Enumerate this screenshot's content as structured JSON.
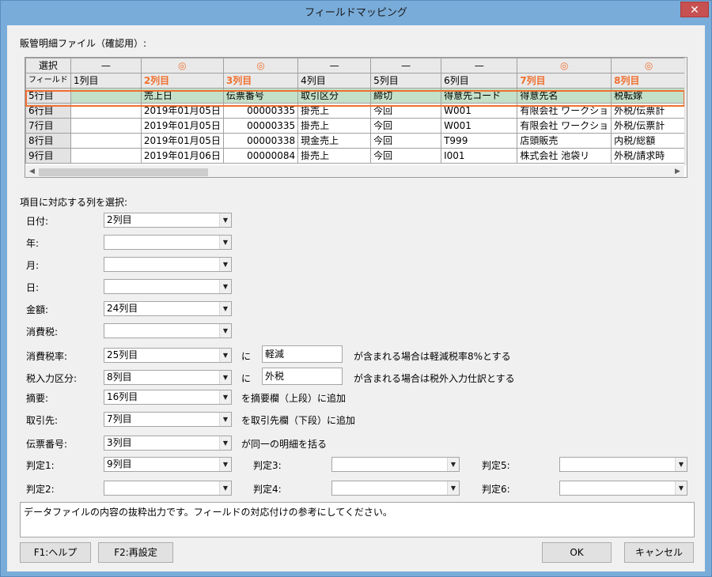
{
  "window": {
    "title": "フィールドマッピング",
    "close_glyph": "✕"
  },
  "section_file": "販管明細ファイル（確認用）:",
  "grid": {
    "corner_top": "選択",
    "corner_bottom": "フィールド",
    "col_marks": [
      "—",
      "◎",
      "◎",
      "—",
      "—",
      "—",
      "◎",
      "◎"
    ],
    "col_headers": [
      "1列目",
      "2列目",
      "3列目",
      "4列目",
      "5列目",
      "6列目",
      "7列目",
      "8列目"
    ],
    "rows": [
      {
        "label": "5行目",
        "cells": [
          "",
          "売上日",
          "伝票番号",
          "取引区分",
          "締切",
          "得意先コード",
          "得意先名",
          "税転嫁"
        ]
      },
      {
        "label": "6行目",
        "cells": [
          "",
          "2019年01月05日",
          "00000335",
          "掛売上",
          "今回",
          "W001",
          "有限会社 ワークショ",
          "外税/伝票計"
        ]
      },
      {
        "label": "7行目",
        "cells": [
          "",
          "2019年01月05日",
          "00000335",
          "掛売上",
          "今回",
          "W001",
          "有限会社 ワークショ",
          "外税/伝票計"
        ]
      },
      {
        "label": "8行目",
        "cells": [
          "",
          "2019年01月05日",
          "00000338",
          "現金売上",
          "今回",
          "T999",
          "店頭販売",
          "内税/総額"
        ]
      },
      {
        "label": "9行目",
        "cells": [
          "",
          "2019年01月06日",
          "00000084",
          "掛売上",
          "今回",
          "I001",
          "株式会社 池袋リ",
          "外税/請求時"
        ]
      }
    ]
  },
  "section_map": "項目に対応する列を選択:",
  "fields": {
    "date": {
      "label": "日付:",
      "value": "2列目"
    },
    "year": {
      "label": "年:",
      "value": ""
    },
    "month": {
      "label": "月:",
      "value": ""
    },
    "day": {
      "label": "日:",
      "value": ""
    },
    "amount": {
      "label": "金額:",
      "value": "24列目"
    },
    "tax": {
      "label": "消費税:",
      "value": ""
    },
    "tax_rate": {
      "label": "消費税率:",
      "value": "25列目",
      "ni": "に",
      "keyword": "軽減",
      "suffix": "が含まれる場合は軽減税率8%とする"
    },
    "tax_input": {
      "label": "税入力区分:",
      "value": "8列目",
      "ni": "に",
      "keyword": "外税",
      "suffix": "が含まれる場合は税外入力仕訳とする"
    },
    "summary": {
      "label": "摘要:",
      "value": "16列目",
      "suffix": "を摘要欄（上段）に追加"
    },
    "partner": {
      "label": "取引先:",
      "value": "7列目",
      "suffix": "を取引先欄（下段）に追加"
    },
    "slip": {
      "label": "伝票番号:",
      "value": "3列目",
      "suffix": "が同一の明細を括る"
    },
    "judge1": {
      "label": "判定1:",
      "value": "9列目"
    },
    "judge2": {
      "label": "判定2:",
      "value": ""
    },
    "judge3": {
      "label": "判定3:",
      "value": ""
    },
    "judge4": {
      "label": "判定4:",
      "value": ""
    },
    "judge5": {
      "label": "判定5:",
      "value": ""
    },
    "judge6": {
      "label": "判定6:",
      "value": ""
    }
  },
  "memo": "データファイルの内容の抜粋出力です。フィールドの対応付けの参考にしてください。",
  "buttons": {
    "help": "F1:ヘルプ",
    "reset": "F2:再設定",
    "ok": "OK",
    "cancel": "キャンセル"
  },
  "colors": {
    "accent": "#f07030",
    "selected_row": "#c4e0c8",
    "titlebar": "#79acd9",
    "close": "#c75050"
  }
}
